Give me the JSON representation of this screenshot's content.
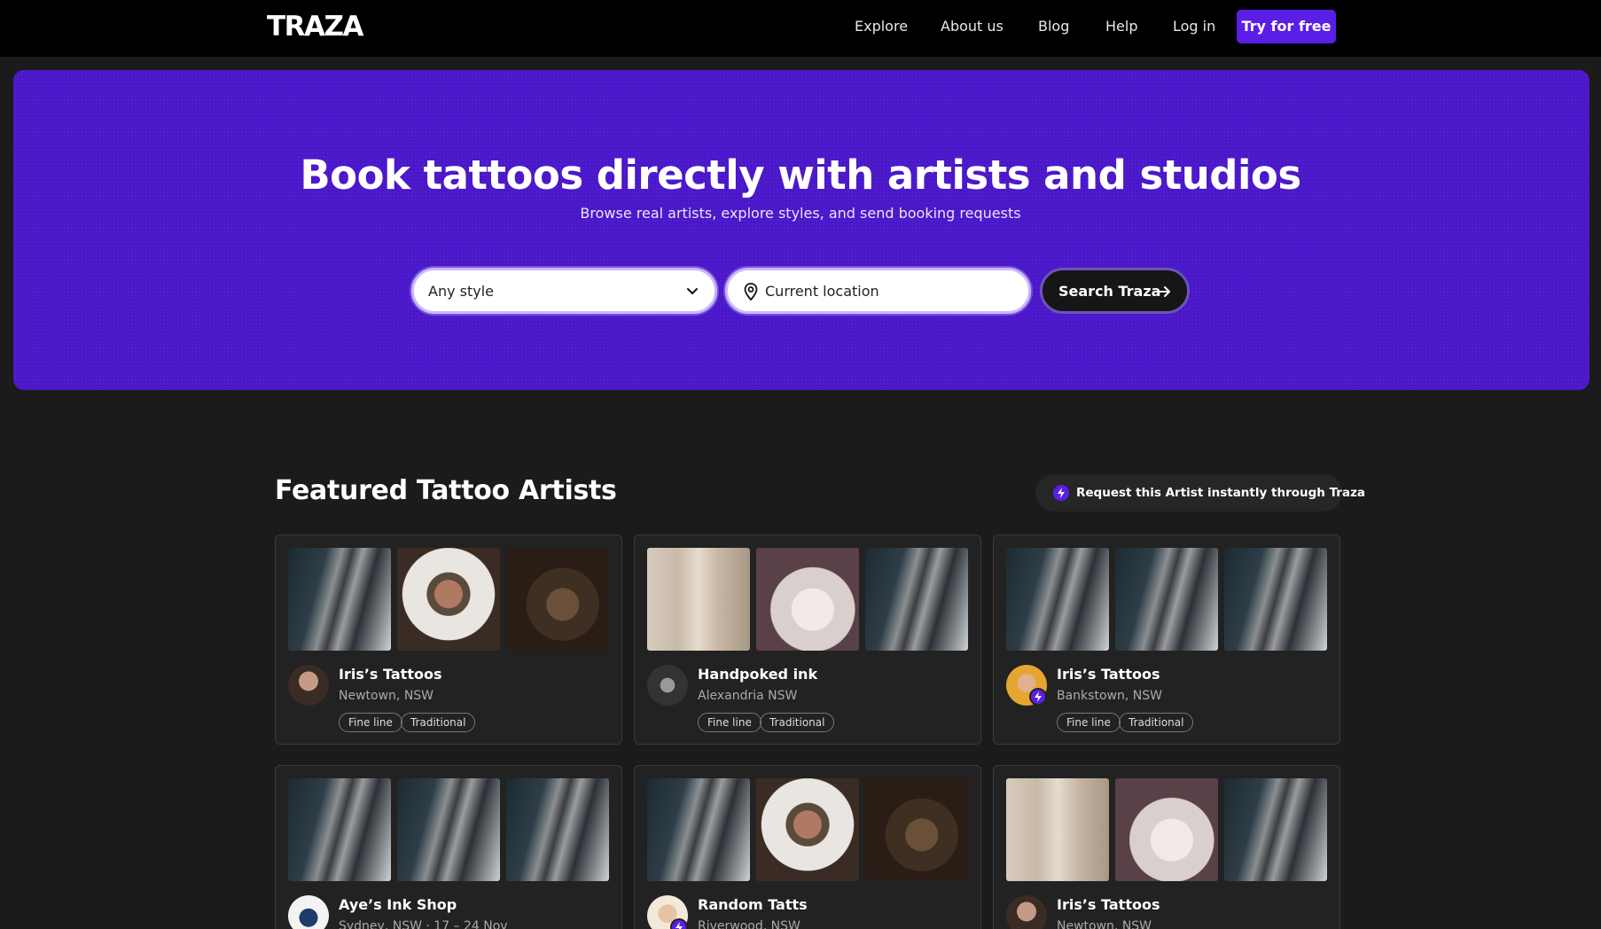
{
  "nav": {
    "logo": "TRAZA",
    "links": [
      "Explore",
      "About us",
      "Blog",
      "Help",
      "Log in"
    ],
    "cta": "Try for free"
  },
  "hero": {
    "title": "Book tattoos directly with artists and studios",
    "subtitle": "Browse real artists, explore styles, and send booking requests",
    "style_select": {
      "value": "Any style"
    },
    "location": {
      "placeholder": "Current location",
      "value": ""
    },
    "search_button": "Search Traza"
  },
  "featured": {
    "title": "Featured Tattoo Artists",
    "request_pill": "Request this Artist instantly through Traza",
    "cards": [
      {
        "name": "Iris’s Tattoos",
        "location": "Newtown, NSW",
        "tags": [
          "Fine line",
          "Traditional"
        ],
        "thumbs": [
          "sleeve-icon",
          "rose-shoulder-icon",
          "floral-shoulder-icon"
        ],
        "avatar": "portrait-dark-icon",
        "verified": false
      },
      {
        "name": "Handpoked ink",
        "location": "Alexandria NSW",
        "tags": [
          "Fine line",
          "Traditional"
        ],
        "thumbs": [
          "fineline-arms-icon",
          "lotus-forearm-icon",
          "sleeve-icon"
        ],
        "avatar": "hands-bw-icon",
        "verified": false
      },
      {
        "name": "Iris’s Tattoos",
        "location": "Bankstown, NSW",
        "tags": [
          "Fine line",
          "Traditional"
        ],
        "thumbs": [
          "sleeve-icon",
          "sleeve-icon",
          "sleeve-icon"
        ],
        "avatar": "portrait-yellow-icon",
        "verified": true
      },
      {
        "name": "Aye’s Ink Shop",
        "location": "Sydney, NSW · 17 – 24 Nov",
        "tags": [],
        "thumbs": [
          "sleeve-icon",
          "sleeve-icon",
          "sleeve-icon"
        ],
        "avatar": "portrait-white-icon",
        "verified": false
      },
      {
        "name": "Random Tatts",
        "location": "Riverwood, NSW",
        "tags": [],
        "thumbs": [
          "sleeve-icon",
          "rose-shoulder-icon",
          "floral-shoulder-icon"
        ],
        "avatar": "portrait-light-icon",
        "verified": true
      },
      {
        "name": "Iris’s Tattoos",
        "location": "Newtown, NSW",
        "tags": [],
        "thumbs": [
          "fineline-arms-icon",
          "lotus-forearm-icon",
          "sleeve-icon"
        ],
        "avatar": "portrait-dark-icon",
        "verified": false
      }
    ]
  },
  "colors": {
    "brand": "#5a1ee6",
    "hero_bg": "#4a17c9",
    "page_bg": "#1b1b1b",
    "card_bg": "#222222"
  }
}
